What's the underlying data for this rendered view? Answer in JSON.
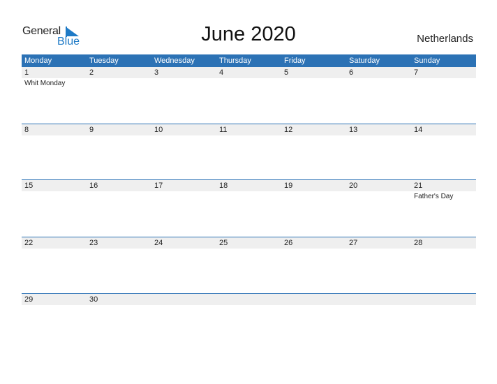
{
  "brand": {
    "line1": "General",
    "line2": "Blue",
    "accent": "#1e7ac6"
  },
  "title": "June 2020",
  "country": "Netherlands",
  "colors": {
    "header_bg": "#2c72b5",
    "date_strip_bg": "#efefef"
  },
  "weekdays": [
    "Monday",
    "Tuesday",
    "Wednesday",
    "Thursday",
    "Friday",
    "Saturday",
    "Sunday"
  ],
  "weeks": [
    {
      "days": [
        "1",
        "2",
        "3",
        "4",
        "5",
        "6",
        "7"
      ],
      "events": [
        "Whit Monday",
        "",
        "",
        "",
        "",
        "",
        ""
      ]
    },
    {
      "days": [
        "8",
        "9",
        "10",
        "11",
        "12",
        "13",
        "14"
      ],
      "events": [
        "",
        "",
        "",
        "",
        "",
        "",
        ""
      ]
    },
    {
      "days": [
        "15",
        "16",
        "17",
        "18",
        "19",
        "20",
        "21"
      ],
      "events": [
        "",
        "",
        "",
        "",
        "",
        "",
        "Father's Day"
      ]
    },
    {
      "days": [
        "22",
        "23",
        "24",
        "25",
        "26",
        "27",
        "28"
      ],
      "events": [
        "",
        "",
        "",
        "",
        "",
        "",
        ""
      ]
    },
    {
      "days": [
        "29",
        "30",
        "",
        "",
        "",
        "",
        ""
      ],
      "events": [
        "",
        "",
        "",
        "",
        "",
        "",
        ""
      ]
    }
  ]
}
